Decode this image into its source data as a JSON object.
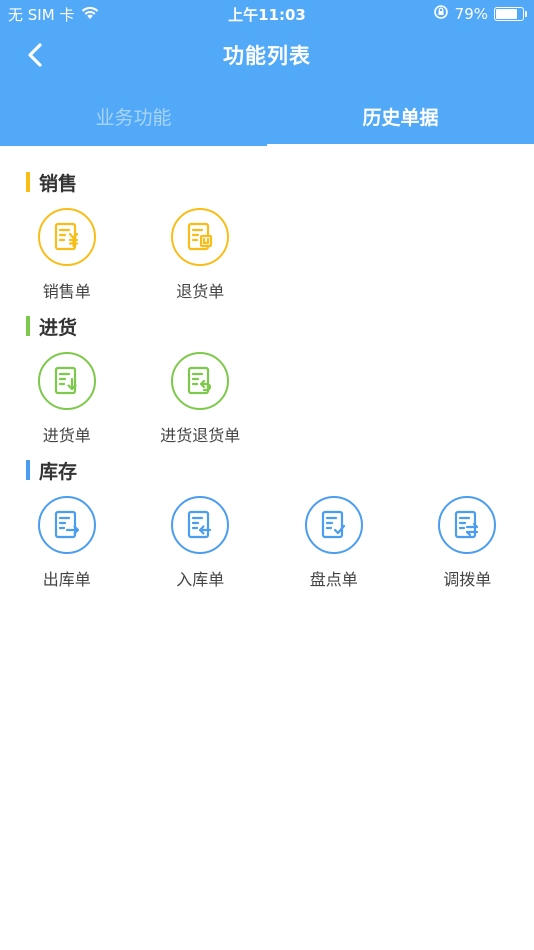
{
  "statusbar": {
    "carrier": "无 SIM 卡",
    "time": "上午11:03",
    "battery": "79%",
    "battery_level": 0.79
  },
  "navbar": {
    "title": "功能列表"
  },
  "tabs": [
    {
      "label": "业务功能",
      "active": false
    },
    {
      "label": "历史单据",
      "active": true
    }
  ],
  "sections": [
    {
      "title": "销售",
      "color": "#f9bd18",
      "items": [
        {
          "label": "销售单",
          "icon": "sales-order-icon"
        },
        {
          "label": "退货单",
          "icon": "return-order-icon"
        }
      ]
    },
    {
      "title": "进货",
      "color": "#7dc94b",
      "items": [
        {
          "label": "进货单",
          "icon": "purchase-order-icon"
        },
        {
          "label": "进货退货单",
          "icon": "purchase-return-icon"
        }
      ]
    },
    {
      "title": "库存",
      "color": "#4a9df0",
      "items": [
        {
          "label": "出库单",
          "icon": "stock-out-icon"
        },
        {
          "label": "入库单",
          "icon": "stock-in-icon"
        },
        {
          "label": "盘点单",
          "icon": "stocktake-icon"
        },
        {
          "label": "调拨单",
          "icon": "transfer-icon"
        }
      ]
    }
  ]
}
